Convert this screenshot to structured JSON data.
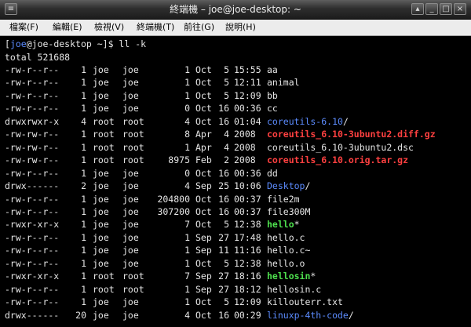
{
  "window": {
    "title": "終端機 – joe@joe-desktop: ~",
    "buttons": {
      "menu": "≡",
      "shade": "▴",
      "minimize": "_",
      "maximize": "□",
      "close": "×"
    }
  },
  "menubar": {
    "items": [
      "檔案(F)",
      "編輯(E)",
      "檢視(V)",
      "終端機(T)",
      "前往(G)",
      "說明(H)"
    ]
  },
  "terminal": {
    "prompt": {
      "open": "[",
      "user": "joe",
      "host": "@joe-desktop ~]$ ",
      "command": "ll -k"
    },
    "total": "total 521688",
    "colors": {
      "dir": "#5c8cff",
      "exec": "#4ee04e",
      "archive": "#ff4040",
      "text": "#e6e6e6"
    },
    "rows": [
      {
        "perm": "-rw-r--r--",
        "links": "1",
        "owner": "joe",
        "group": "joe",
        "size": "1",
        "mon": "Oct",
        "day": "5",
        "time": "15:55",
        "name": "aa",
        "suffix": "",
        "type": "file"
      },
      {
        "perm": "-rw-r--r--",
        "links": "1",
        "owner": "joe",
        "group": "joe",
        "size": "1",
        "mon": "Oct",
        "day": "5",
        "time": "12:11",
        "name": "animal",
        "suffix": "",
        "type": "file"
      },
      {
        "perm": "-rw-r--r--",
        "links": "1",
        "owner": "joe",
        "group": "joe",
        "size": "1",
        "mon": "Oct",
        "day": "5",
        "time": "12:09",
        "name": "bb",
        "suffix": "",
        "type": "file"
      },
      {
        "perm": "-rw-r--r--",
        "links": "1",
        "owner": "joe",
        "group": "joe",
        "size": "0",
        "mon": "Oct",
        "day": "16",
        "time": "00:36",
        "name": "cc",
        "suffix": "",
        "type": "file"
      },
      {
        "perm": "drwxrwxr-x",
        "links": "4",
        "owner": "root",
        "group": "root",
        "size": "4",
        "mon": "Oct",
        "day": "16",
        "time": "01:04",
        "name": "coreutils-6.10",
        "suffix": "/",
        "type": "dir"
      },
      {
        "perm": "-rw-rw-r--",
        "links": "1",
        "owner": "root",
        "group": "root",
        "size": "8",
        "mon": "Apr",
        "day": "4",
        "time": "2008",
        "name": "coreutils_6.10-3ubuntu2.diff.gz",
        "suffix": "",
        "type": "archive"
      },
      {
        "perm": "-rw-rw-r--",
        "links": "1",
        "owner": "root",
        "group": "root",
        "size": "1",
        "mon": "Apr",
        "day": "4",
        "time": "2008",
        "name": "coreutils_6.10-3ubuntu2.dsc",
        "suffix": "",
        "type": "file"
      },
      {
        "perm": "-rw-rw-r--",
        "links": "1",
        "owner": "root",
        "group": "root",
        "size": "8975",
        "mon": "Feb",
        "day": "2",
        "time": "2008",
        "name": "coreutils_6.10.orig.tar.gz",
        "suffix": "",
        "type": "archive"
      },
      {
        "perm": "-rw-r--r--",
        "links": "1",
        "owner": "joe",
        "group": "joe",
        "size": "0",
        "mon": "Oct",
        "day": "16",
        "time": "00:36",
        "name": "dd",
        "suffix": "",
        "type": "file"
      },
      {
        "perm": "drwx------",
        "links": "2",
        "owner": "joe",
        "group": "joe",
        "size": "4",
        "mon": "Sep",
        "day": "25",
        "time": "10:06",
        "name": "Desktop",
        "suffix": "/",
        "type": "dir"
      },
      {
        "perm": "-rw-r--r--",
        "links": "1",
        "owner": "joe",
        "group": "joe",
        "size": "204800",
        "mon": "Oct",
        "day": "16",
        "time": "00:37",
        "name": "file2m",
        "suffix": "",
        "type": "file"
      },
      {
        "perm": "-rw-r--r--",
        "links": "1",
        "owner": "joe",
        "group": "joe",
        "size": "307200",
        "mon": "Oct",
        "day": "16",
        "time": "00:37",
        "name": "file300M",
        "suffix": "",
        "type": "file"
      },
      {
        "perm": "-rwxr-xr-x",
        "links": "1",
        "owner": "joe",
        "group": "joe",
        "size": "7",
        "mon": "Oct",
        "day": "5",
        "time": "12:38",
        "name": "hello",
        "suffix": "*",
        "type": "exec"
      },
      {
        "perm": "-rw-r--r--",
        "links": "1",
        "owner": "joe",
        "group": "joe",
        "size": "1",
        "mon": "Sep",
        "day": "27",
        "time": "17:48",
        "name": "hello.c",
        "suffix": "",
        "type": "file"
      },
      {
        "perm": "-rw-r--r--",
        "links": "1",
        "owner": "joe",
        "group": "joe",
        "size": "1",
        "mon": "Sep",
        "day": "11",
        "time": "11:16",
        "name": "hello.c~",
        "suffix": "",
        "type": "file"
      },
      {
        "perm": "-rw-r--r--",
        "links": "1",
        "owner": "joe",
        "group": "joe",
        "size": "1",
        "mon": "Oct",
        "day": "5",
        "time": "12:38",
        "name": "hello.o",
        "suffix": "",
        "type": "file"
      },
      {
        "perm": "-rwxr-xr-x",
        "links": "1",
        "owner": "root",
        "group": "root",
        "size": "7",
        "mon": "Sep",
        "day": "27",
        "time": "18:16",
        "name": "hellosin",
        "suffix": "*",
        "type": "exec"
      },
      {
        "perm": "-rw-r--r--",
        "links": "1",
        "owner": "root",
        "group": "root",
        "size": "1",
        "mon": "Sep",
        "day": "27",
        "time": "18:12",
        "name": "hellosin.c",
        "suffix": "",
        "type": "file"
      },
      {
        "perm": "-rw-r--r--",
        "links": "1",
        "owner": "joe",
        "group": "joe",
        "size": "1",
        "mon": "Oct",
        "day": "5",
        "time": "12:09",
        "name": "killouterr.txt",
        "suffix": "",
        "type": "file"
      },
      {
        "perm": "drwx------",
        "links": "20",
        "owner": "joe",
        "group": "joe",
        "size": "4",
        "mon": "Oct",
        "day": "16",
        "time": "00:29",
        "name": "linuxp-4th-code",
        "suffix": "/",
        "type": "dir"
      }
    ]
  }
}
